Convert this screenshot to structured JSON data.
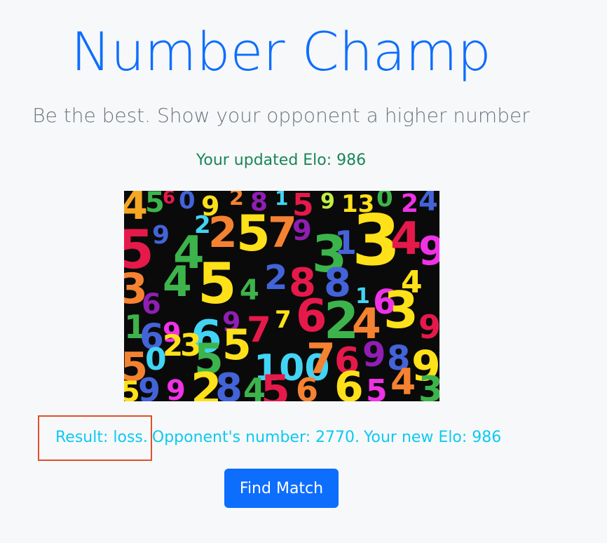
{
  "header": {
    "title": "Number Champ",
    "subtitle": "Be the best. Show your opponent a higher number"
  },
  "status": {
    "updated_elo": "Your updated Elo: 986"
  },
  "result": {
    "outcome": "Result: loss.",
    "opponent_number": "Opponent's number: 2770.",
    "new_elo": "Your new Elo: 986"
  },
  "actions": {
    "find_match_label": "Find Match"
  },
  "colors": {
    "brand_blue": "#0d6efd",
    "success_green": "#198754",
    "info_cyan": "#0dcaf0",
    "highlight_red": "#e0502a"
  }
}
